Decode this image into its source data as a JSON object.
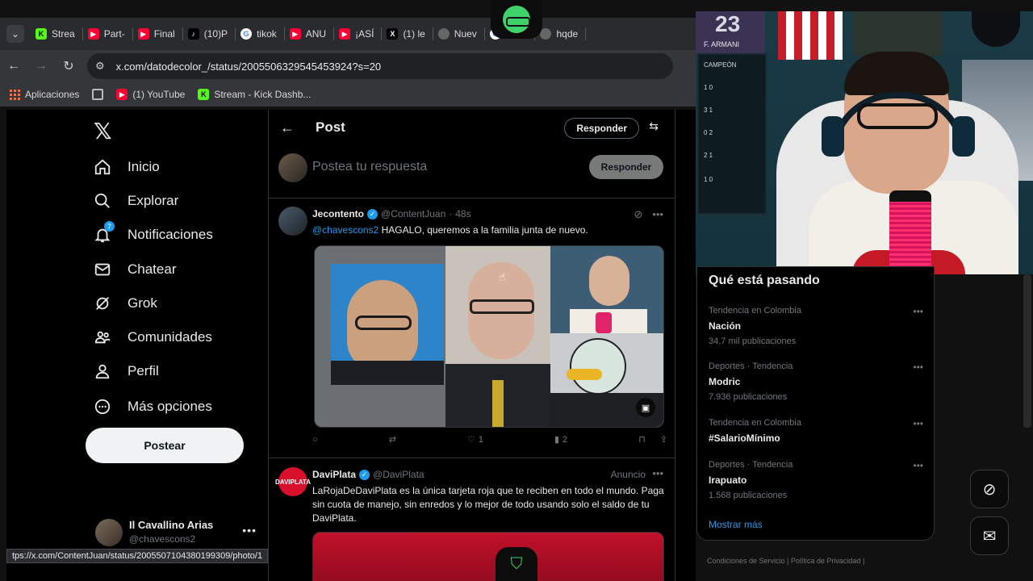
{
  "browser": {
    "tabs": [
      {
        "label": "Strea",
        "icon": "kick"
      },
      {
        "label": "Part-",
        "icon": "youtube"
      },
      {
        "label": "Final",
        "icon": "youtube"
      },
      {
        "label": "(10)P",
        "icon": "tiktok"
      },
      {
        "label": "tikok",
        "icon": "google"
      },
      {
        "label": "ANU",
        "icon": "youtube"
      },
      {
        "label": "¡ASÍ",
        "icon": "youtube"
      },
      {
        "label": "(1) le",
        "icon": "x"
      },
      {
        "label": "Nuev",
        "icon": "globe"
      },
      {
        "label": "mem",
        "icon": "google"
      },
      {
        "label": "hqde",
        "icon": "globe"
      }
    ],
    "url": "x.com/datodecolor_/status/2005506329545453924?s=20",
    "bookmarks": [
      {
        "label": "Aplicaciones"
      },
      {
        "label": "(1) YouTube"
      },
      {
        "label": "Stream - Kick Dashb..."
      }
    ],
    "status_url": "tps://x.com/ContentJuan/status/2005507104380199309/photo/1"
  },
  "sidebar": {
    "items": [
      {
        "label": "Inicio",
        "icon": "home-icon"
      },
      {
        "label": "Explorar",
        "icon": "search-icon"
      },
      {
        "label": "Notificaciones",
        "icon": "bell-icon",
        "badge": "7"
      },
      {
        "label": "Chatear",
        "icon": "mail-icon"
      },
      {
        "label": "Grok",
        "icon": "grok-icon"
      },
      {
        "label": "Comunidades",
        "icon": "people-icon"
      },
      {
        "label": "Perfil",
        "icon": "person-icon"
      },
      {
        "label": "Más opciones",
        "icon": "more-circle-icon"
      }
    ],
    "post_button": "Postear",
    "account": {
      "name": "Il Cavallino Arias",
      "handle": "@chavescons2"
    }
  },
  "main": {
    "title": "Post",
    "reply_pill": "Responder",
    "compose": {
      "placeholder": "Postea tu respuesta",
      "button": "Responder"
    },
    "tweet": {
      "name": "Jecontento",
      "handle": "@ContentJuan",
      "time": "48s",
      "mention": "@chavescons2",
      "text": " HAGALO, queremos a la familia junta de nuevo.",
      "likes": "1",
      "views": "2"
    },
    "ad": {
      "name": "DaviPlata",
      "handle": "@DaviPlata",
      "label": "Anuncio",
      "avatar_text": "DAVIPLATA",
      "text": "LaRojaDeDaviPlata es la única tarjeta roja que te reciben en todo el mundo. Paga sin cuota de manejo, sin enredos y lo mejor de todo usando solo el saldo de tu DaviPlata."
    }
  },
  "trends": {
    "title": "Qué está pasando",
    "items": [
      {
        "context": "Tendencia en Colombia",
        "title": "Nación",
        "count": "34,7 mil publicaciones"
      },
      {
        "context": "Deportes · Tendencia",
        "title": "Modric",
        "count": "7.936 publicaciones"
      },
      {
        "context": "Tendencia en Colombia",
        "title": "#SalarioMínimo",
        "count": ""
      },
      {
        "context": "Deportes · Tendencia",
        "title": "Irapuato",
        "count": "1.568 publicaciones"
      }
    ],
    "show_more": "Mostrar más",
    "footer": "Condiciones de Servicio  |  Política de Privacidad  |"
  },
  "webcam": {
    "jersey_number": "23",
    "jersey_name": "F. ARMANI",
    "frame_lines": [
      "CAMPEÓN",
      "1  0",
      "3  1",
      "0  2",
      "2  1",
      "1  0"
    ]
  },
  "colors": {
    "accent": "#1d9bf0",
    "kick_green": "#53fc18",
    "youtube_red": "#ff0033",
    "daviplata_red": "#d8102c"
  }
}
